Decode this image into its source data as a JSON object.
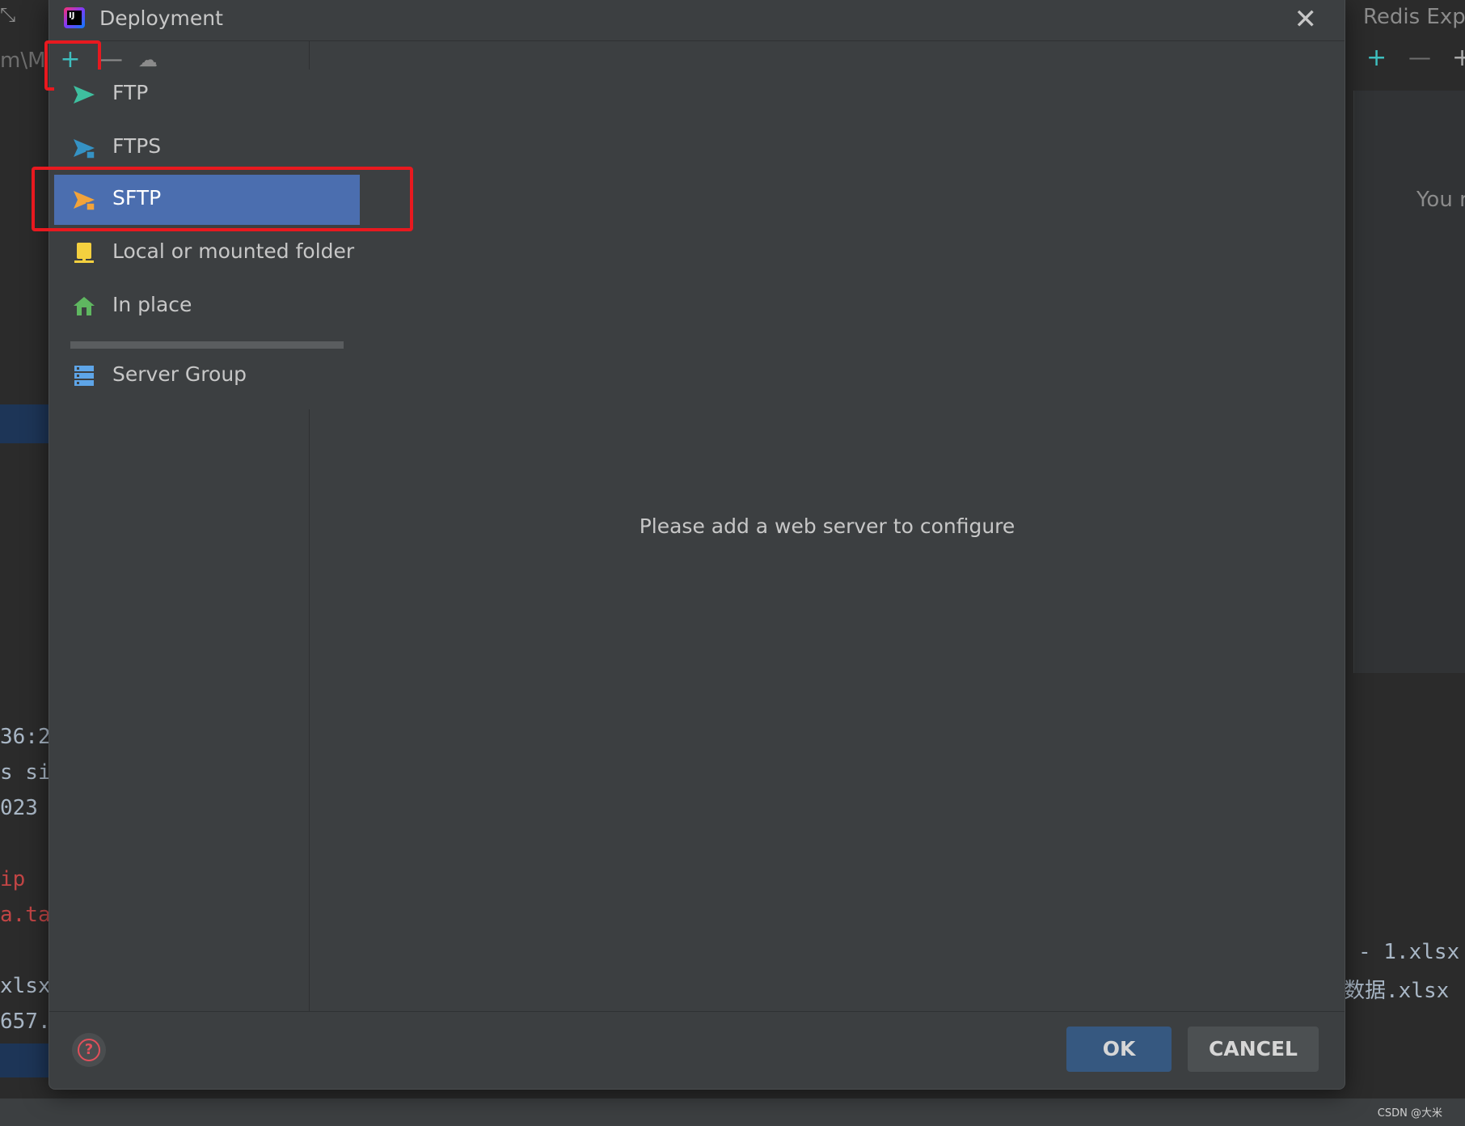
{
  "dialog": {
    "title": "Deployment",
    "empty_message": "Please add a web server to configure",
    "ok_label": "OK",
    "cancel_label": "CANCEL"
  },
  "toolbar": {
    "add": "+",
    "remove": "—"
  },
  "menu": {
    "items": [
      {
        "label": "FTP"
      },
      {
        "label": "FTPS"
      },
      {
        "label": "SFTP"
      },
      {
        "label": "Local or mounted folder"
      },
      {
        "label": "In place"
      },
      {
        "label": "Server Group"
      }
    ],
    "selected": "SFTP"
  },
  "background": {
    "left_code": [
      "36:2",
      "s si",
      "023",
      "ip",
      "a.ta",
      "xlsx",
      "657."
    ],
    "left_path": "m\\M",
    "right_title": "Redis Explo",
    "right_text": "You r",
    "right_files": [
      "- 1.xlsx",
      "数据.xlsx"
    ]
  },
  "watermark": "CSDN @大米",
  "colors": {
    "highlight": "#e8191f",
    "selection": "#4b6eaf",
    "ok_button": "#365880"
  }
}
